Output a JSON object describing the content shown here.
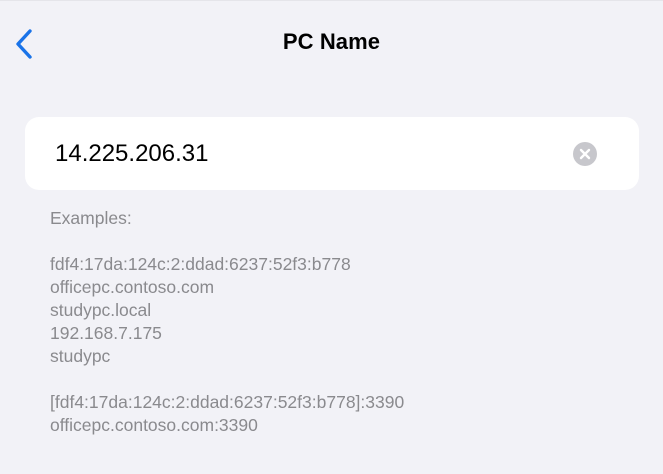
{
  "nav": {
    "back_icon": "chevron-left-icon",
    "title": "PC Name",
    "accent_color": "#1a73e8"
  },
  "input": {
    "value": "14.225.206.31",
    "clear_icon": "clear-circle-x-icon"
  },
  "examples": {
    "heading": "Examples:",
    "group1": [
      "fdf4:17da:124c:2:ddad:6237:52f3:b778",
      "officepc.contoso.com",
      "studypc.local",
      "192.168.7.175",
      "studypc"
    ],
    "group2": [
      "[fdf4:17da:124c:2:ddad:6237:52f3:b778]:3390",
      "officepc.contoso.com:3390"
    ]
  }
}
